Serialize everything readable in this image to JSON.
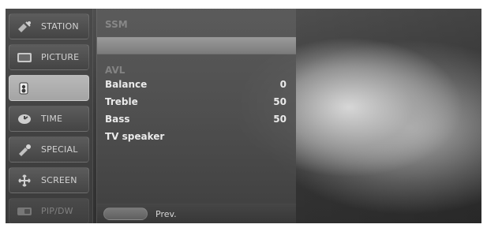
{
  "sidebar": {
    "items": [
      {
        "label": "STATION",
        "icon": "satellite-icon"
      },
      {
        "label": "PICTURE",
        "icon": "tv-icon"
      },
      {
        "label": "",
        "icon": "speaker-icon"
      },
      {
        "label": "TIME",
        "icon": "clock-icon"
      },
      {
        "label": "SPECIAL",
        "icon": "tools-icon"
      },
      {
        "label": "SCREEN",
        "icon": "screen-icon"
      },
      {
        "label": "PIP/DW",
        "icon": "pip-icon"
      }
    ]
  },
  "panel": {
    "rows": [
      {
        "label": "SSM",
        "value": ""
      },
      {
        "label": "",
        "value": ""
      },
      {
        "label": "AVL",
        "value": ""
      },
      {
        "label": "Balance",
        "value": "0"
      },
      {
        "label": "Treble",
        "value": "50"
      },
      {
        "label": "Bass",
        "value": "50"
      },
      {
        "label": "TV speaker",
        "value": ""
      }
    ],
    "footer": {
      "prev_label": "Prev."
    }
  }
}
